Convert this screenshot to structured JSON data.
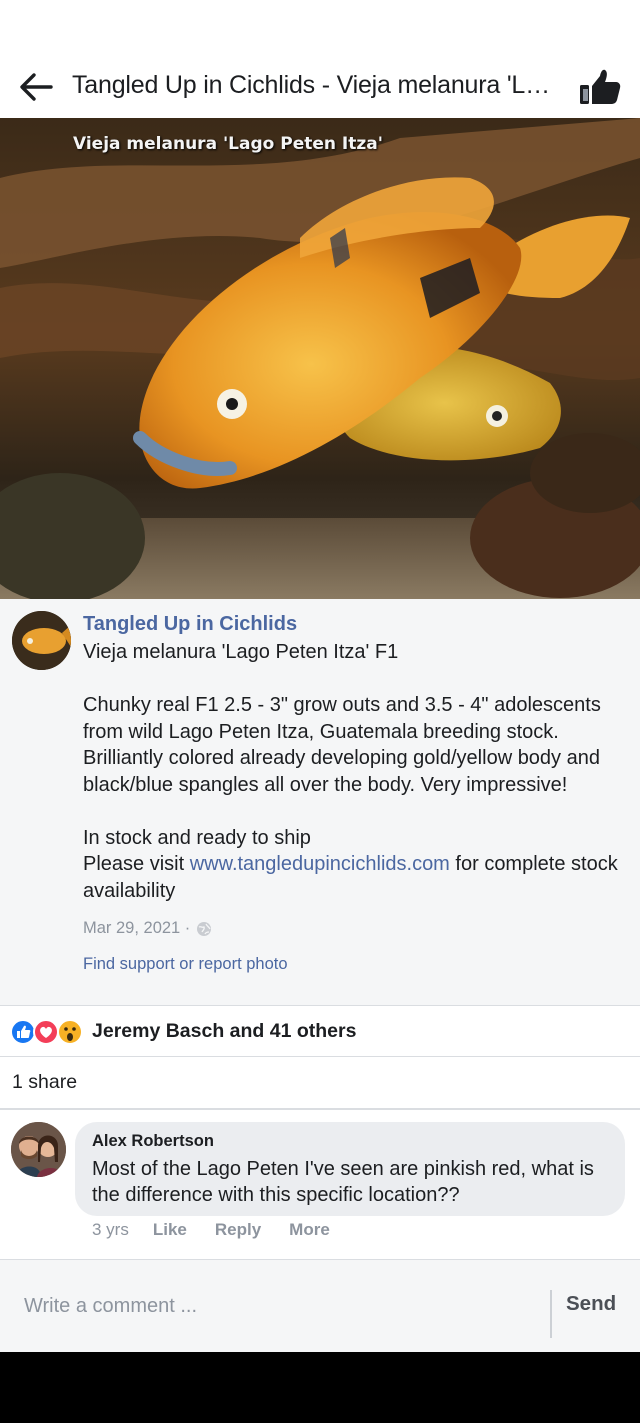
{
  "header": {
    "title": "Tangled Up in Cichlids - Vieja melanura 'Lago Peten Itza' F1"
  },
  "photo": {
    "caption": "Vieja melanura 'Lago Peten Itza'"
  },
  "post": {
    "page_name": "Tangled Up in Cichlids",
    "line1": "Vieja melanura 'Lago Peten Itza' F1",
    "para1": "Chunky real F1 2.5 - 3\" grow outs and 3.5 - 4\" adolescents from wild Lago Peten Itza, Guatemala breeding stock. Brilliantly colored already developing gold/yellow body and black/blue spangles all over the body. Very impressive!",
    "para2_line1": "In stock and ready to ship",
    "para2_pre": "Please visit ",
    "link": "www.tangledupincichlids.com",
    "para2_post": " for complete stock availability",
    "date": "Mar 29, 2021 ·",
    "privacy_icon": "globe-icon",
    "report": "Find support or report photo"
  },
  "reactions": {
    "icons": [
      "like-icon",
      "love-icon",
      "wow-icon"
    ],
    "text": "Jeremy Basch and 41 others"
  },
  "shares": {
    "text": "1 share"
  },
  "comment": {
    "author": "Alex Robertson",
    "text": "Most of the Lago Peten I've seen are pinkish red, what is the difference with this specific location??",
    "time": "3 yrs",
    "like": "Like",
    "reply": "Reply",
    "more": "More"
  },
  "composer": {
    "placeholder": "Write a comment ...",
    "send": "Send"
  },
  "colors": {
    "link": "#4b67a1",
    "muted": "#8d949e",
    "like_blue": "#1877f2",
    "love_red": "#f33e58",
    "wow_yellow": "#f7b125"
  }
}
